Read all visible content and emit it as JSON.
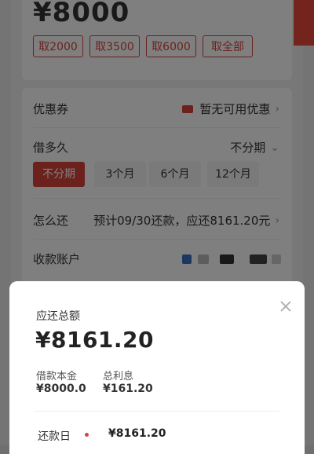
{
  "amount": {
    "display": "¥8000"
  },
  "quick_withdraw": [
    "取2000",
    "取3500",
    "取6000",
    "取全部"
  ],
  "coupon": {
    "label": "优惠券",
    "value": "暂无可用优惠"
  },
  "term": {
    "label": "借多久",
    "selected": "不分期",
    "options": [
      "不分期",
      "3个月",
      "6个月",
      "12个月"
    ]
  },
  "repay_plan": {
    "label": "怎么还",
    "value": "预计09/30还款，应还8161.20元"
  },
  "account": {
    "label": "收款账户"
  },
  "sheet": {
    "title": "应还总额",
    "total": "¥8161.20",
    "principal_label": "借款本金",
    "principal_value": "¥8000.0",
    "interest_label": "总利息",
    "interest_value": "¥161.20",
    "repay_day_label": "还款日",
    "repay_day_value": "¥8161.20"
  },
  "colors": {
    "accent": "#d6453a"
  }
}
